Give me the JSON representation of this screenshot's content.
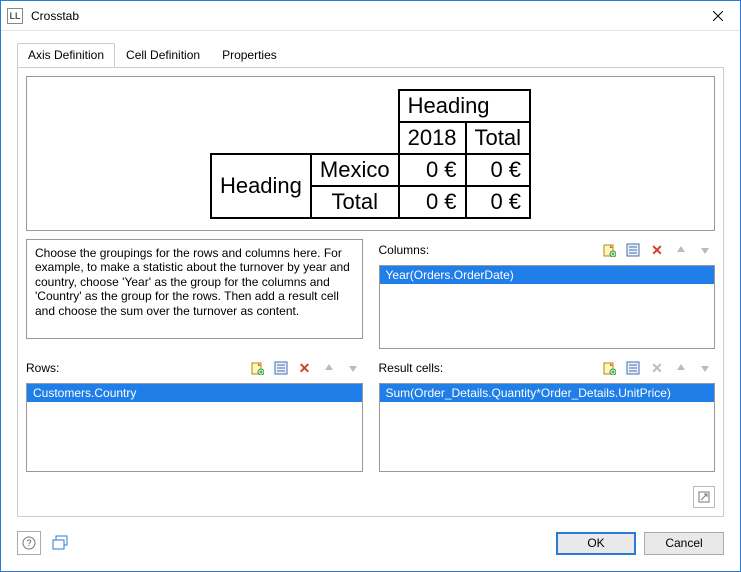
{
  "window": {
    "title": "Crosstab"
  },
  "tabs": {
    "axis": "Axis Definition",
    "cell": "Cell Definition",
    "props": "Properties"
  },
  "preview": {
    "row_heading": "Heading",
    "col_heading": "Heading",
    "col_sample": "2018",
    "col_total": "Total",
    "row_sample": "Mexico",
    "row_total": "Total",
    "value_zero": "0 €"
  },
  "help_text": "Choose the groupings for the rows and columns here. For example, to make a statistic about the turnover by year and country, choose 'Year' as the group for the columns and 'Country' as the group for the rows. Then add a result cell and choose the sum over the turnover as content.",
  "columns": {
    "label": "Columns:",
    "items": [
      "Year(Orders.OrderDate)"
    ]
  },
  "rows": {
    "label": "Rows:",
    "items": [
      "Customers.Country"
    ]
  },
  "result": {
    "label": "Result cells:",
    "items": [
      "Sum(Order_Details.Quantity*Order_Details.UnitPrice)"
    ]
  },
  "footer": {
    "ok": "OK",
    "cancel": "Cancel"
  }
}
